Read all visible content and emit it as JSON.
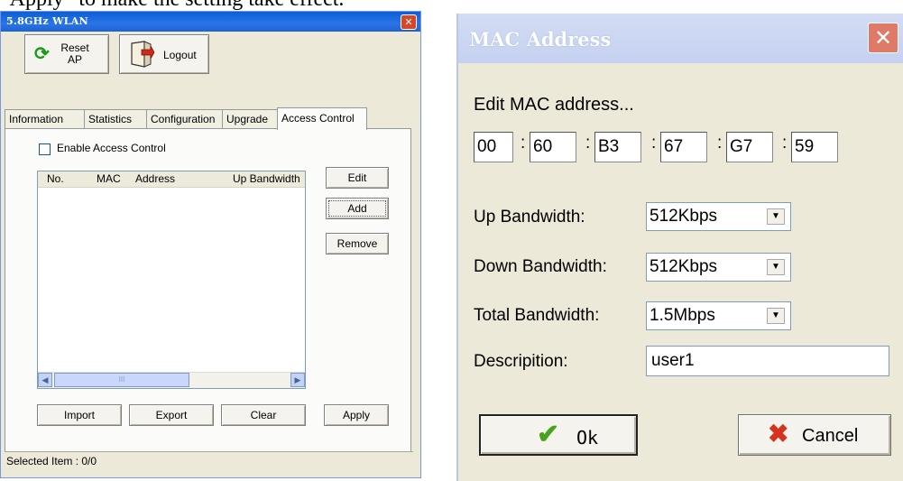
{
  "caption": "“Apply” to make the setting take effect.",
  "wlan_window": {
    "title": "5.8GHz WLAN",
    "close_glyph": "✕",
    "reset_button": {
      "line1": "Reset",
      "line2": "AP"
    },
    "logout_button": "Logout",
    "tabs": [
      "Information",
      "Statistics",
      "Configuration",
      "Upgrade",
      "Access Control"
    ],
    "active_tab": "Access Control",
    "enable_checkbox": {
      "label": "Enable Access Control",
      "checked": false
    },
    "list_headers": [
      "No.",
      "MAC",
      "Address",
      "Up Bandwidth"
    ],
    "scroll_left": "◀",
    "scroll_right": "▶",
    "scroll_grip": "III",
    "side_buttons": {
      "edit": "Edit",
      "add": "Add",
      "remove": "Remove"
    },
    "bottom_buttons": {
      "import": "Import",
      "export": "Export",
      "clear": "Clear",
      "apply": "Apply"
    },
    "status": "Selected Item : 0/0"
  },
  "mac_dialog": {
    "title": "MAC Address",
    "close_glyph": "✕",
    "edit_label": "Edit MAC address...",
    "mac_octets": [
      "00",
      "60",
      "B3",
      "67",
      "G7",
      "59"
    ],
    "separator": ":",
    "up_bandwidth": {
      "label": "Up Bandwidth:",
      "value": "512Kbps"
    },
    "down_bandwidth": {
      "label": "Down Bandwidth:",
      "value": "512Kbps"
    },
    "total_bandwidth": {
      "label": "Total Bandwidth:",
      "value": "1.5Mbps"
    },
    "description": {
      "label": "Descripition:",
      "value": "user1"
    },
    "dropdown_arrow": "▼",
    "ok_button": {
      "icon": "✔",
      "label": "Ok"
    },
    "cancel_button": {
      "icon": "✖",
      "label": "Cancel"
    }
  }
}
